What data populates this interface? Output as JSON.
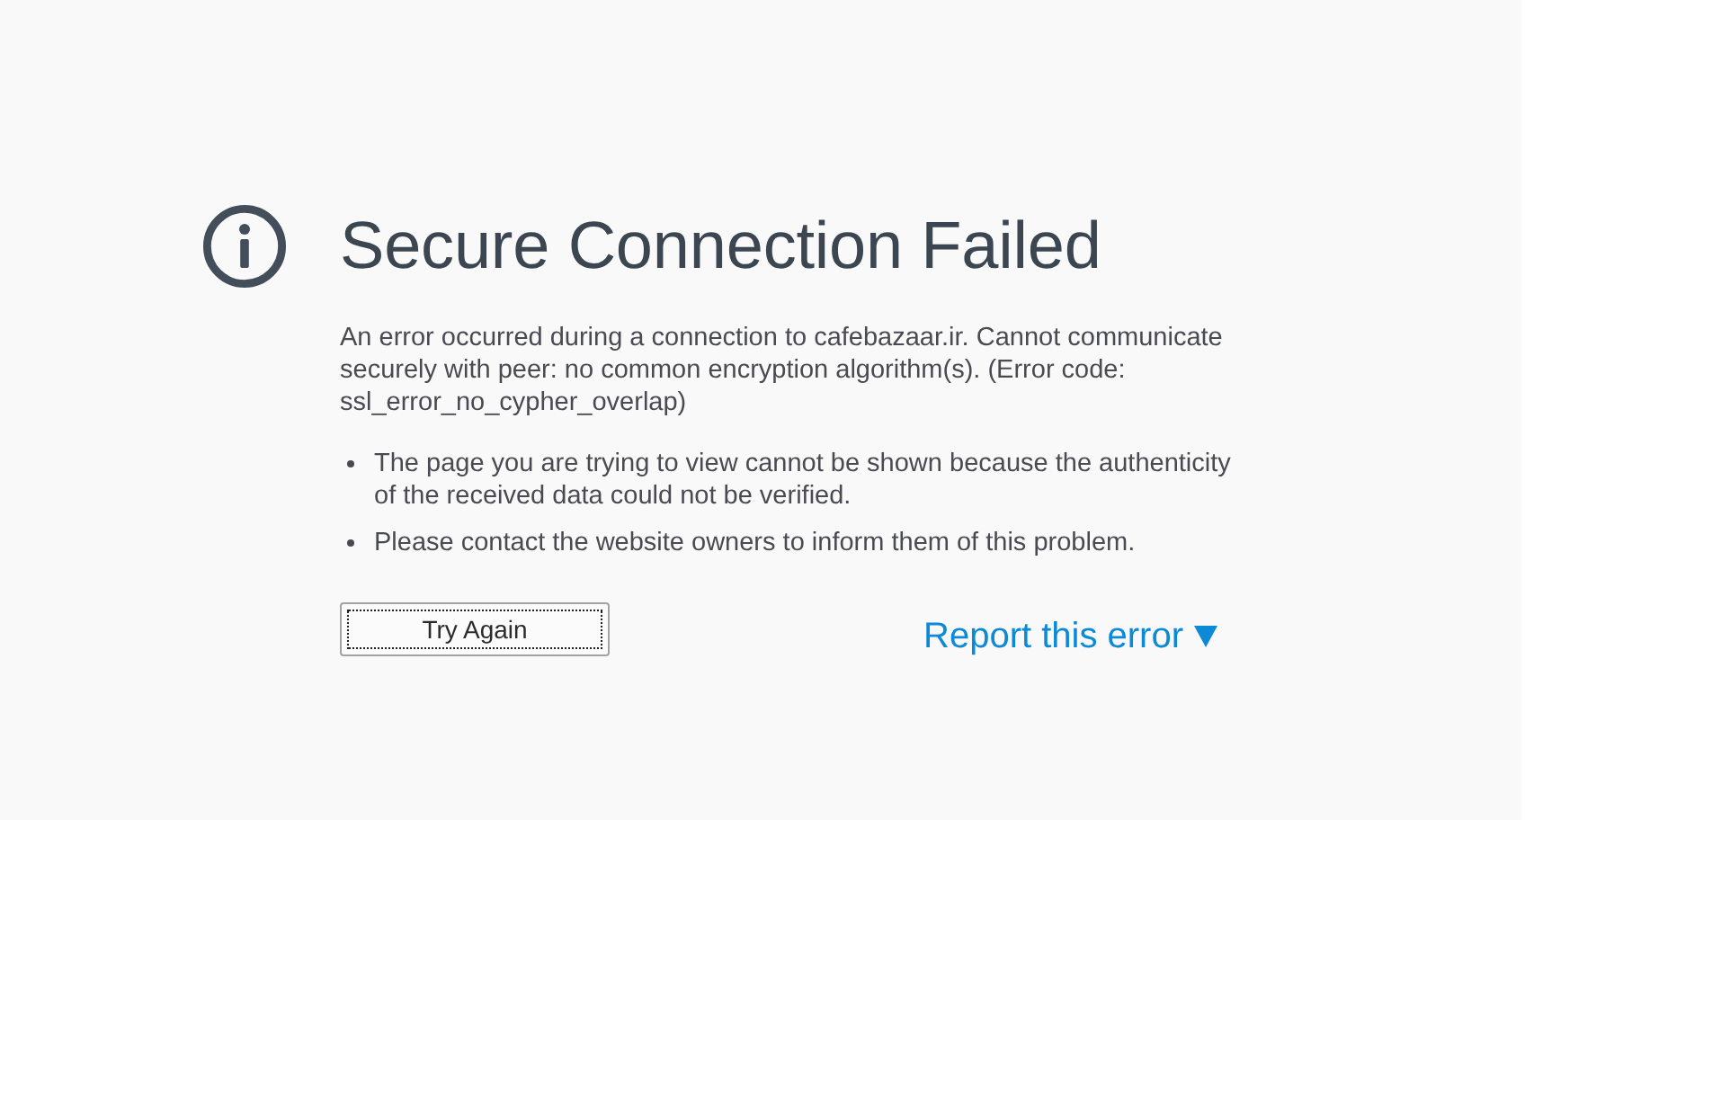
{
  "page": {
    "title": "Secure Connection Failed",
    "description": "An error occurred during a connection to cafebazaar.ir. Cannot communicate securely with peer: no common encryption algorithm(s). (Error code: ssl_error_no_cypher_overlap)",
    "bullets": [
      "The page you are trying to view cannot be shown because the authenticity of the received data could not be verified.",
      "Please contact the website owners to inform them of this problem."
    ],
    "try_again_button": {
      "label": "Try Again",
      "focused": true
    },
    "report_link": {
      "label": "Report this error"
    }
  }
}
